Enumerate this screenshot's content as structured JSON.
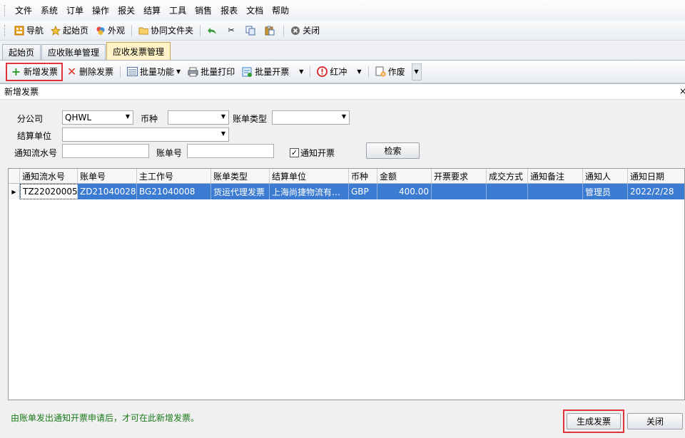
{
  "menubar": {
    "items": [
      "文件",
      "系统",
      "订单",
      "操作",
      "报关",
      "结算",
      "工具",
      "销售",
      "报表",
      "文档",
      "帮助"
    ]
  },
  "toolbar": {
    "nav_label": "导航",
    "home_label": "起始页",
    "appearance_label": "外观",
    "shared_folder_label": "协同文件夹",
    "close_label": "关闭"
  },
  "tabs": [
    {
      "label": "起始页",
      "active": false
    },
    {
      "label": "应收账单管理",
      "active": false
    },
    {
      "label": "应收发票管理",
      "active": true
    }
  ],
  "subtoolbar": {
    "add_invoice": "新增发票",
    "delete_invoice": "删除发票",
    "batch_function": "批量功能",
    "batch_print": "批量打印",
    "batch_issue": "批量开票",
    "red_reverse": "红冲",
    "void": "作废"
  },
  "dialog": {
    "title": "新增发票",
    "close_glyph": "×",
    "filters": {
      "branch_label": "分公司",
      "branch_value": "QHWL",
      "currency_label": "币种",
      "currency_value": "",
      "bill_type_label": "账单类型",
      "bill_type_value": "",
      "settlement_unit_label": "结算单位",
      "settlement_unit_value": "",
      "notice_no_label": "通知流水号",
      "notice_no_value": "",
      "bill_no_label": "账单号",
      "bill_no_value": "",
      "notify_invoice_label": "通知开票",
      "notify_invoice_checked": true,
      "search_button": "检索"
    },
    "grid": {
      "columns": [
        "通知流水号",
        "账单号",
        "主工作号",
        "账单类型",
        "结算单位",
        "币种",
        "金额",
        "开票要求",
        "成交方式",
        "通知备注",
        "通知人",
        "通知日期"
      ],
      "rows": [
        {
          "notice_no": "TZ22020005",
          "bill_no": "ZD21040028",
          "main_job_no": "BG21040008",
          "bill_type": "货运代理发票",
          "settlement_unit": "上海尚捷物流有…",
          "currency": "GBP",
          "amount": "400.00",
          "invoice_req": "",
          "deal_method": "",
          "notice_remark": "",
          "notifier": "管理员",
          "notice_date": "2022/2/28"
        }
      ]
    },
    "footer_note": "由账单发出通知开票申请后，才可在此新增发票。",
    "generate_button": "生成发票",
    "close_button": "关闭"
  },
  "colors": {
    "highlight": "#e0333b",
    "selection": "#3b7bd2",
    "footer_note": "#1a7a1a"
  }
}
